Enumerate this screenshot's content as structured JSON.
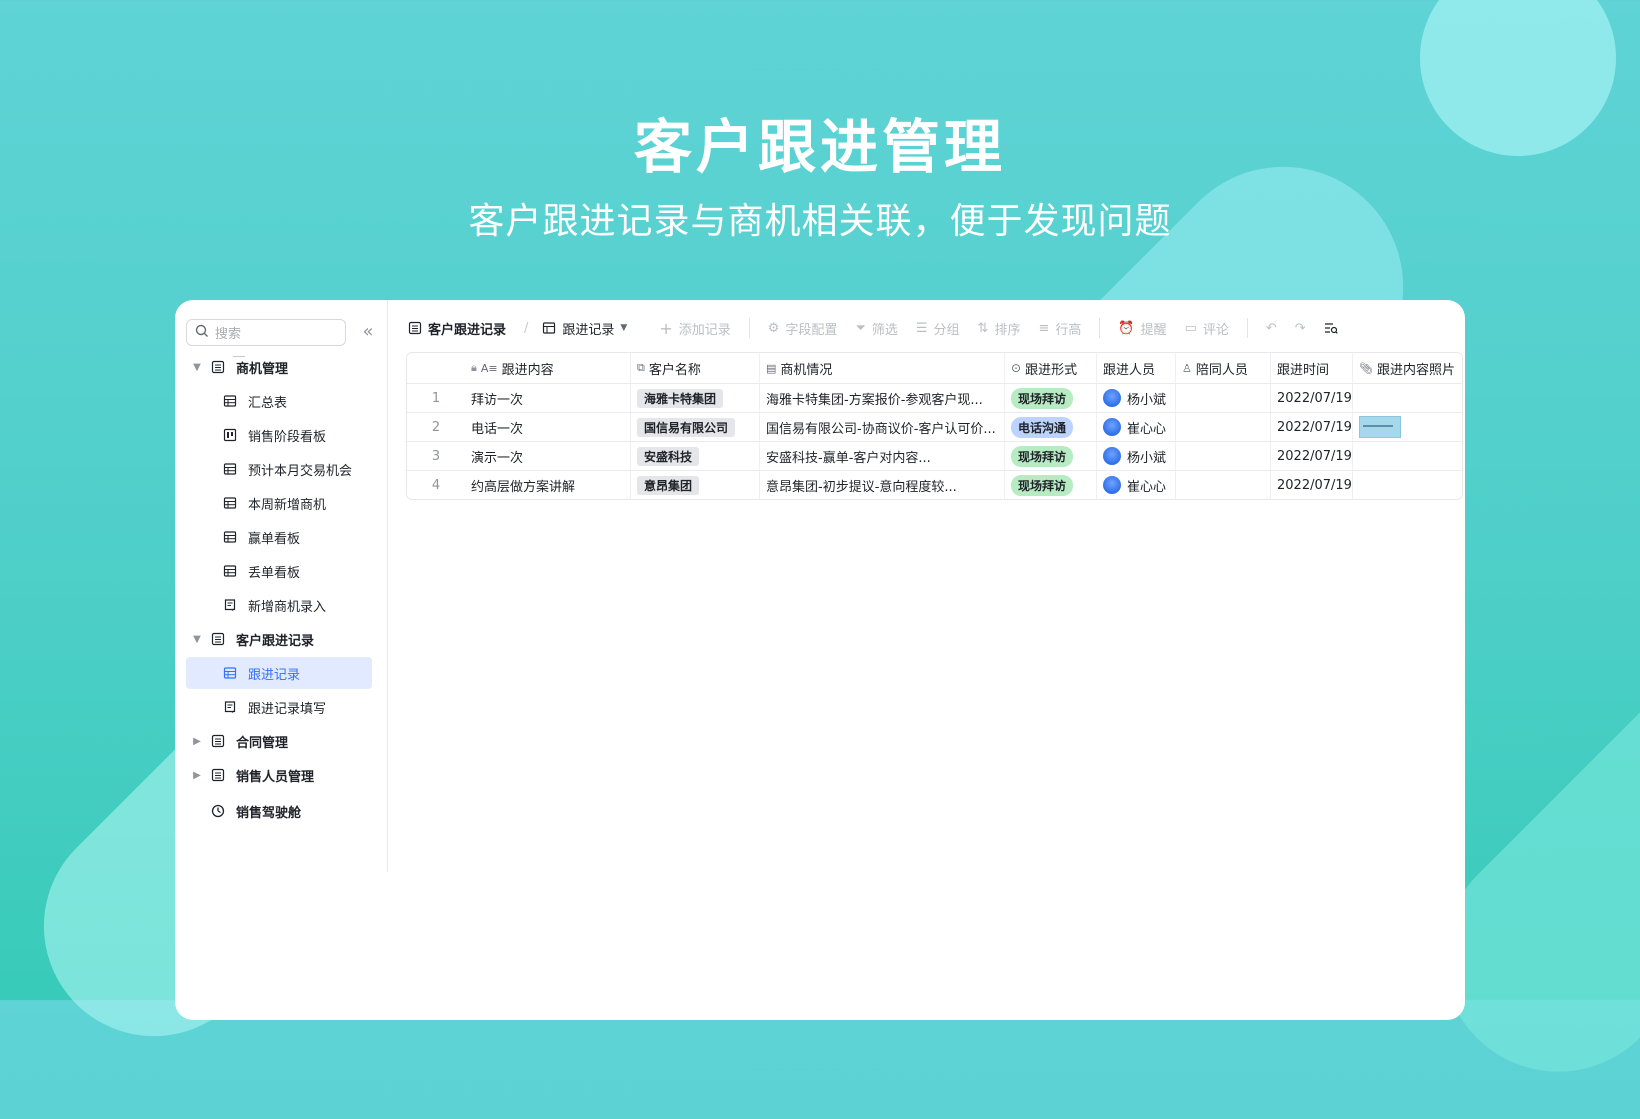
{
  "hero": {
    "title": "客户跟进管理",
    "subtitle": "客户跟进记录与商机相关联，便于发现问题"
  },
  "sidebar": {
    "search_placeholder": "搜索",
    "items": [
      {
        "label": "商机管理",
        "icon": "table-doc-icon",
        "type": "group",
        "expanded": true
      },
      {
        "label": "汇总表",
        "icon": "grid-icon",
        "type": "child"
      },
      {
        "label": "销售阶段看板",
        "icon": "kanban-icon",
        "type": "child"
      },
      {
        "label": "预计本月交易机会",
        "icon": "grid-icon",
        "type": "child"
      },
      {
        "label": "本周新增商机",
        "icon": "grid-icon",
        "type": "child"
      },
      {
        "label": "赢单看板",
        "icon": "grid-icon",
        "type": "child"
      },
      {
        "label": "丢单看板",
        "icon": "grid-icon",
        "type": "child"
      },
      {
        "label": "新增商机录入",
        "icon": "form-icon",
        "type": "child"
      },
      {
        "label": "客户跟进记录",
        "icon": "table-doc-icon",
        "type": "group",
        "expanded": true
      },
      {
        "label": "跟进记录",
        "icon": "grid-icon",
        "type": "child",
        "active": true
      },
      {
        "label": "跟进记录填写",
        "icon": "form-icon",
        "type": "child"
      },
      {
        "label": "合同管理",
        "icon": "table-doc-icon",
        "type": "group",
        "expanded": false
      },
      {
        "label": "销售人员管理",
        "icon": "table-doc-icon",
        "type": "group",
        "expanded": false
      },
      {
        "label": "销售驾驶舱",
        "icon": "dashboard-icon",
        "type": "group-single"
      }
    ]
  },
  "toolbar": {
    "table_name": "客户跟进记录",
    "view_name": "跟进记录",
    "add_record": "添加记录",
    "field_config": "字段配置",
    "filter": "筛选",
    "group": "分组",
    "sort": "排序",
    "row_height": "行高",
    "remind": "提醒",
    "comment": "评论"
  },
  "table": {
    "columns": [
      "跟进内容",
      "客户名称",
      "商机情况",
      "跟进形式",
      "跟进人员",
      "陪同人员",
      "跟进时间",
      "跟进内容照片"
    ],
    "rows": [
      {
        "idx": "1",
        "content": "拜访一次",
        "customer": "海雅卡特集团",
        "opportunity": "海雅卡特集团-方案报价-参观客户现...",
        "form": "现场拜访",
        "form_color": "green",
        "person": "杨小斌",
        "companion": "",
        "time": "2022/07/19",
        "photo": false
      },
      {
        "idx": "2",
        "content": "电话一次",
        "customer": "国信易有限公司",
        "opportunity": "国信易有限公司-协商议价-客户认可价...",
        "form": "电话沟通",
        "form_color": "blue",
        "person": "崔心心",
        "companion": "",
        "time": "2022/07/19",
        "photo": true
      },
      {
        "idx": "3",
        "content": "演示一次",
        "customer": "安盛科技",
        "opportunity": "安盛科技-赢单-客户对内容...",
        "form": "现场拜访",
        "form_color": "green",
        "person": "杨小斌",
        "companion": "",
        "time": "2022/07/19",
        "photo": false
      },
      {
        "idx": "4",
        "content": "约高层做方案讲解",
        "customer": "意昂集团",
        "opportunity": "意昂集团-初步提议-意向程度较...",
        "form": "现场拜访",
        "form_color": "green",
        "person": "崔心心",
        "companion": "",
        "time": "2022/07/19",
        "photo": false
      }
    ]
  },
  "colors": {
    "accent": "#3370ff",
    "tag_green": "#b7ecc3",
    "tag_blue": "#bcd3ff"
  }
}
